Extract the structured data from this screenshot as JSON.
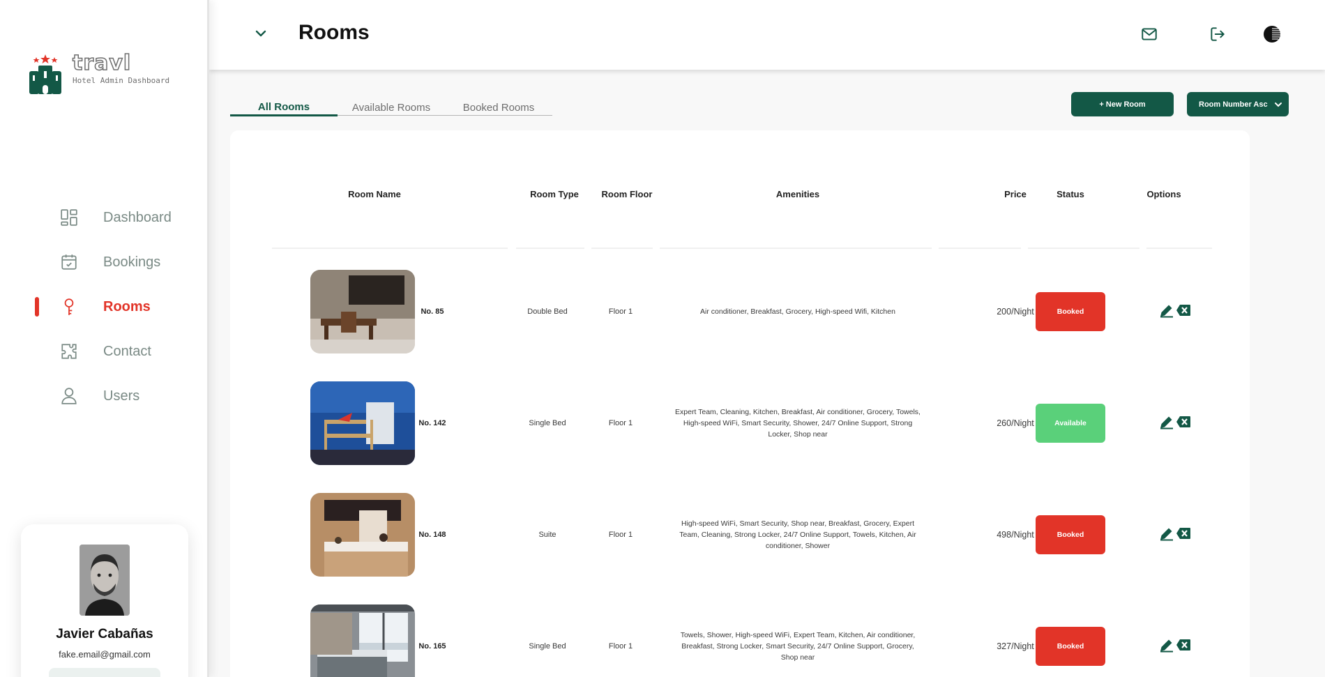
{
  "brand": {
    "name": "travl",
    "subtitle": "Hotel Admin Dashboard"
  },
  "colors": {
    "primary": "#135846",
    "danger": "#e23428",
    "success": "#5ad07a",
    "muted": "#7a8a85"
  },
  "nav": [
    {
      "label": "Dashboard",
      "icon": "dashboard-icon"
    },
    {
      "label": "Bookings",
      "icon": "calendar-icon"
    },
    {
      "label": "Rooms",
      "icon": "key-icon",
      "active": true
    },
    {
      "label": "Contact",
      "icon": "puzzle-icon"
    },
    {
      "label": "Users",
      "icon": "user-icon"
    }
  ],
  "user": {
    "name": "Javier Cabañas",
    "email": "fake.email@gmail.com"
  },
  "header": {
    "title": "Rooms",
    "icons": [
      "chevron-down-icon",
      "mail-icon",
      "logout-icon",
      "theme-toggle-icon"
    ]
  },
  "tabs": [
    "All Rooms",
    "Available Rooms",
    "Booked Rooms"
  ],
  "actions": {
    "new_room": "+ New Room",
    "sort_value": "Room Number Asc"
  },
  "table": {
    "columns": [
      "Room Name",
      "Room Type",
      "Room Floor",
      "Amenities",
      "Price",
      "Status",
      "Options"
    ],
    "rows": [
      {
        "number": "No. 85",
        "type": "Double Bed",
        "floor": "Floor 1",
        "amenities": "Air conditioner, Breakfast, Grocery, High-speed Wifi, Kitchen",
        "price": "200/Night",
        "status": "Booked"
      },
      {
        "number": "No. 142",
        "type": "Single Bed",
        "floor": "Floor 1",
        "amenities": "Expert Team, Cleaning, Kitchen, Breakfast, Air conditioner, Grocery, Towels, High-speed WiFi, Smart Security, Shower, 24/7 Online Support, Strong Locker, Shop near",
        "price": "260/Night",
        "status": "Available"
      },
      {
        "number": "No. 148",
        "type": "Suite",
        "floor": "Floor 1",
        "amenities": "High-speed WiFi, Smart Security, Shop near, Breakfast, Grocery, Expert Team, Cleaning, Strong Locker, 24/7 Online Support, Towels, Kitchen, Air conditioner, Shower",
        "price": "498/Night",
        "status": "Booked"
      },
      {
        "number": "No. 165",
        "type": "Single Bed",
        "floor": "Floor 1",
        "amenities": "Towels, Shower, High-speed WiFi, Expert Team, Kitchen, Air conditioner, Breakfast, Strong Locker, Smart Security, 24/7 Online Support, Grocery, Shop near",
        "price": "327/Night",
        "status": "Booked"
      }
    ]
  }
}
